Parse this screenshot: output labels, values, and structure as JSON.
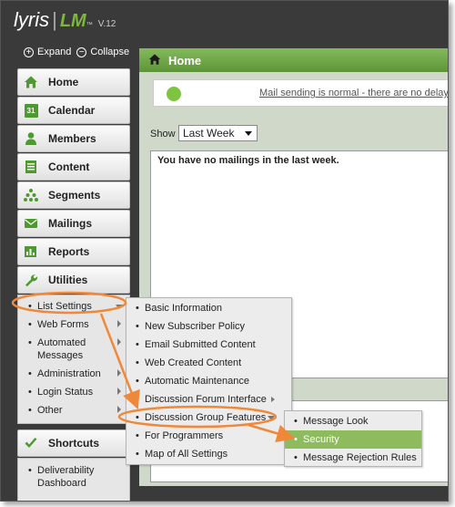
{
  "header": {
    "brand": "lyris",
    "product": "LM",
    "trademark": "™",
    "version": "V.12"
  },
  "expand_bar": {
    "expand_icon": "+",
    "expand_label": "Expand",
    "collapse_icon": "−",
    "collapse_label": "Collapse"
  },
  "sidebar": {
    "items": [
      {
        "label": "Home",
        "icon": "house-icon"
      },
      {
        "label": "Calendar",
        "icon": "calendar-icon",
        "icon_text": "31"
      },
      {
        "label": "Members",
        "icon": "person-icon"
      },
      {
        "label": "Content",
        "icon": "document-icon"
      },
      {
        "label": "Segments",
        "icon": "segments-icon"
      },
      {
        "label": "Mailings",
        "icon": "envelope-icon"
      },
      {
        "label": "Reports",
        "icon": "reports-icon"
      },
      {
        "label": "Utilities",
        "icon": "wrench-icon"
      }
    ],
    "sub_items": [
      {
        "label": "List Settings",
        "has_arrow": true,
        "active": true
      },
      {
        "label": "Web Forms",
        "has_arrow": true
      },
      {
        "label": "Automated Messages",
        "has_arrow": true
      },
      {
        "label": "Administration",
        "has_arrow": true
      },
      {
        "label": "Login Status",
        "has_arrow": true
      },
      {
        "label": "Other",
        "has_arrow": true
      }
    ],
    "shortcuts": {
      "label": "Shortcuts",
      "icon": "checkmark-icon",
      "items": [
        {
          "label": "Deliverability Dashboard"
        }
      ]
    }
  },
  "main": {
    "title": "Home",
    "status_text": "Mail sending is normal - there are no delayed",
    "show_label": "Show",
    "show_select": {
      "value": "Last Week"
    },
    "mailings_message": "You have no mailings in the last week."
  },
  "flyout_list_settings": [
    {
      "label": "Basic Information"
    },
    {
      "label": "New Subscriber Policy"
    },
    {
      "label": "Email Submitted Content"
    },
    {
      "label": "Web Created Content"
    },
    {
      "label": "Automatic Maintenance"
    },
    {
      "label": "Discussion Forum Interface",
      "has_arrow": true
    },
    {
      "label": "Discussion Group Features",
      "has_arrow": true,
      "active": true
    },
    {
      "label": "For Programmers"
    },
    {
      "label": "Map of All Settings"
    }
  ],
  "flyout_discussion": [
    {
      "label": "Message Look"
    },
    {
      "label": "Security",
      "selected": true
    },
    {
      "label": "Message Rejection Rules"
    }
  ],
  "colors": {
    "accent_green": "#5c9538",
    "highlight_orange": "#f0883a",
    "selected_green": "#8dbb5e",
    "frame_dark": "#3a3a3a"
  }
}
